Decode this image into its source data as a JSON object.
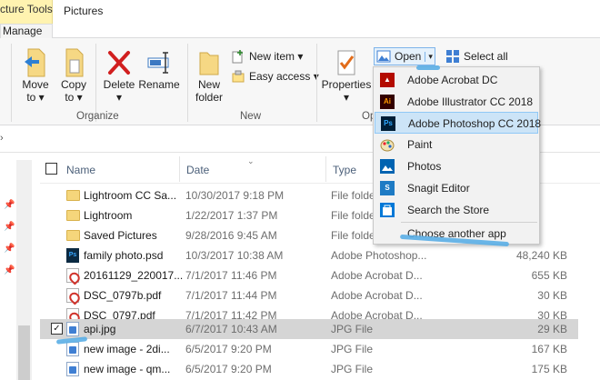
{
  "ribbon_tabs": {
    "contextual_title": "cture Tools",
    "contextual_sub": "Manage",
    "pictures": "Pictures"
  },
  "ribbon": {
    "organize": {
      "move_to": "Move",
      "move_to_2": "to ▾",
      "copy_to": "Copy",
      "copy_to_2": "to ▾",
      "delete": "Delete",
      "delete_2": "▾",
      "rename": "Rename",
      "label": "Organize"
    },
    "new": {
      "new_folder": "New",
      "new_folder_2": "folder",
      "new_item": "New item ▾",
      "easy_access": "Easy access ▾",
      "label": "New"
    },
    "open": {
      "properties": "Properties",
      "properties_2": "▾",
      "open": "Open",
      "open_caret": "▾",
      "label": "Op"
    },
    "select": {
      "select_all": "Select all"
    }
  },
  "columns": {
    "name": "Name",
    "date": "Date",
    "type": "Type"
  },
  "files": [
    {
      "name": "Lightroom CC Sa...",
      "date": "10/30/2017 9:18 PM",
      "type": "File folde",
      "size": "",
      "kind": "folder"
    },
    {
      "name": "Lightroom",
      "date": "1/22/2017 1:37 PM",
      "type": "File folde",
      "size": "",
      "kind": "folder"
    },
    {
      "name": "Saved Pictures",
      "date": "9/28/2016 9:45 AM",
      "type": "File folde",
      "size": "",
      "kind": "folder"
    },
    {
      "name": "family photo.psd",
      "date": "10/3/2017 10:38 AM",
      "type": "Adobe Photoshop...",
      "size": "48,240 KB",
      "kind": "psd"
    },
    {
      "name": "20161129_220017...",
      "date": "7/1/2017 11:46 PM",
      "type": "Adobe Acrobat D...",
      "size": "655 KB",
      "kind": "pdf"
    },
    {
      "name": "DSC_0797b.pdf",
      "date": "7/1/2017 11:44 PM",
      "type": "Adobe Acrobat D...",
      "size": "30 KB",
      "kind": "pdf"
    },
    {
      "name": "DSC_0797.pdf",
      "date": "7/1/2017 11:42 PM",
      "type": "Adobe Acrobat D...",
      "size": "30 KB",
      "kind": "pdf"
    },
    {
      "name": "api.jpg",
      "date": "6/7/2017 10:43 AM",
      "type": "JPG File",
      "size": "29 KB",
      "kind": "jpg",
      "selected": true
    },
    {
      "name": "new image - 2di...",
      "date": "6/5/2017 9:20 PM",
      "type": "JPG File",
      "size": "167 KB",
      "kind": "jpg"
    },
    {
      "name": "new image - qm...",
      "date": "6/5/2017 9:20 PM",
      "type": "JPG File",
      "size": "175 KB",
      "kind": "jpg"
    }
  ],
  "open_menu": [
    {
      "label": "Adobe Acrobat DC",
      "icon": "acrobat-icon"
    },
    {
      "label": "Adobe Illustrator CC 2018",
      "icon": "illustrator-icon"
    },
    {
      "label": "Adobe Photoshop CC 2018",
      "icon": "photoshop-icon",
      "highlighted": true
    },
    {
      "label": "Paint",
      "icon": "paint-icon"
    },
    {
      "label": "Photos",
      "icon": "photos-icon"
    },
    {
      "label": "Snagit Editor",
      "icon": "snagit-icon"
    },
    {
      "label": "Search the Store",
      "icon": "store-icon"
    },
    {
      "label": "Choose another app",
      "icon": ""
    }
  ],
  "icon_glyphs": {
    "illustrator": "Ai",
    "photoshop": "Ps",
    "psd_file": "Ps"
  },
  "colors": {
    "accent": "#0078d7",
    "highlight": "#cce4f7",
    "selected_row": "#d5d5d5",
    "scribble": "#5aaee6"
  }
}
